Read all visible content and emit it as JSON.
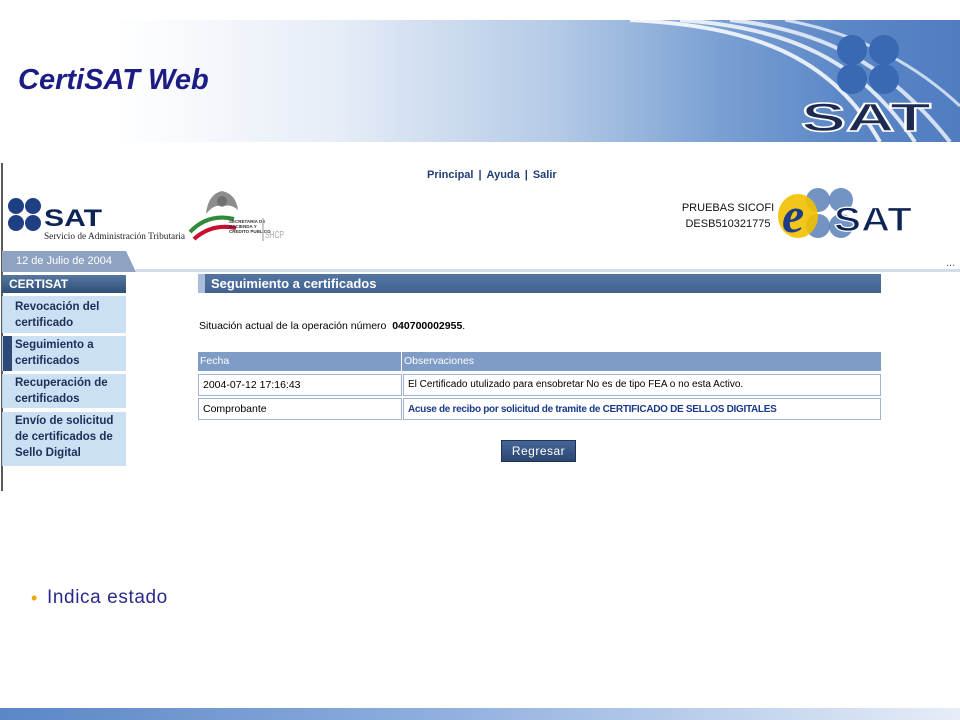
{
  "slide": {
    "title": "CertiSAT Web",
    "bullet": "Indica estado"
  },
  "banner_logo": {
    "text": "SAT"
  },
  "nav": {
    "links": [
      "Principal",
      "Ayuda",
      "Salir"
    ],
    "separator": "|"
  },
  "header": {
    "sat_logo": {
      "name": "SAT",
      "subtitle": "Servicio de Administración Tributaria"
    },
    "hacienda_logo": {
      "lines": [
        "SECRETARIA DE",
        "HACIENDA Y",
        "CREDITO PUBLICO"
      ],
      "abbr": "SHCP"
    },
    "user": {
      "environment": "PRUEBAS SICOFI",
      "rfc": "DESB510321775"
    },
    "esat_logo": {
      "e": "e",
      "name": "SAT"
    }
  },
  "date": "12 de Julio de 2004",
  "more": "...",
  "sidebar": {
    "header": "CERTISAT",
    "items": [
      {
        "lines": [
          "Revocación del",
          "certificado"
        ]
      },
      {
        "lines": [
          "Seguimiento a",
          "certificados"
        ],
        "selected": true
      },
      {
        "lines": [
          "Recuperación de",
          "certificados"
        ]
      },
      {
        "lines": [
          "Envío de solicitud",
          "de certificados de",
          "Sello Digital"
        ]
      }
    ]
  },
  "main": {
    "section_title": "Seguimiento a certificados",
    "status_label": "Situación actual de la operación número",
    "operation_number": "040700002955",
    "status_end": ".",
    "table": {
      "headers": [
        "Fecha",
        "Observaciones"
      ],
      "rows": [
        [
          "2004-07-12 17:16:43",
          "El Certificado utulizado para ensobretar No es de tipo FEA o no esta Activo."
        ],
        [
          "Comprobante",
          "Acuse de recibo por solicitud de tramite de CERTIFICADO DE SELLOS DIGITALES"
        ]
      ]
    },
    "back_button": "Regresar"
  },
  "colors": {
    "title": "#1c1c84",
    "nav_link": "#1e3f75",
    "section_header": "#4b6b97",
    "table_header": "#7e9cc5",
    "sidebar_item": "#cbe0f2",
    "link": "#1a3a8a",
    "bullet": "#f0a500",
    "button": "#2b4670"
  }
}
